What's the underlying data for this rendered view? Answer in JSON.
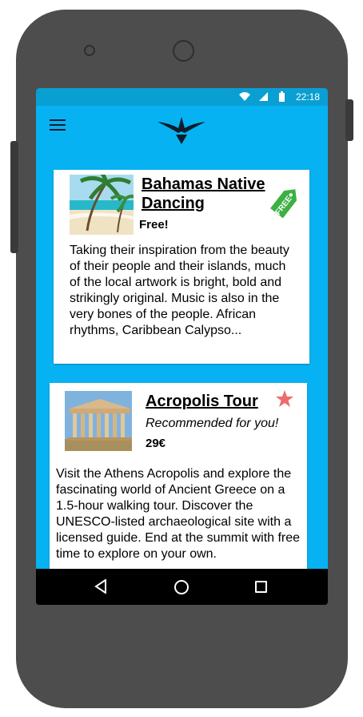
{
  "status_bar": {
    "time": "22:18",
    "icons": [
      "wifi-icon",
      "signal-icon",
      "battery-icon"
    ]
  },
  "app_bar": {
    "menu_icon": "menu-icon",
    "logo_icon": "bird-logo-icon"
  },
  "cards": [
    {
      "title": "Bahamas Native Dancing",
      "price": "Free!",
      "tag": "FREE",
      "description": "Taking their inspiration from the beauty of their people and their islands, much of the local artwork is bright, bold and strikingly original. Music is also in the very bones of the people. African rhythms, Caribbean Calypso..."
    },
    {
      "title": "Acropolis Tour",
      "recommendation": "Recommended for you!",
      "price": "29€",
      "description": "Visit the Athens Acropolis and explore the fascinating world of Ancient Greece on a 1.5-hour walking tour. Discover the UNESCO-listed archaeological site with a licensed guide. End at the summit with free time to explore on your own."
    }
  ],
  "colors": {
    "primary": "#07b2f2",
    "status_bar": "#0a9fd3",
    "free_tag": "#3cb043",
    "star": "#ee6b6b"
  },
  "nav_bar": {
    "icons": [
      "back-icon",
      "home-icon",
      "recent-apps-icon"
    ]
  }
}
